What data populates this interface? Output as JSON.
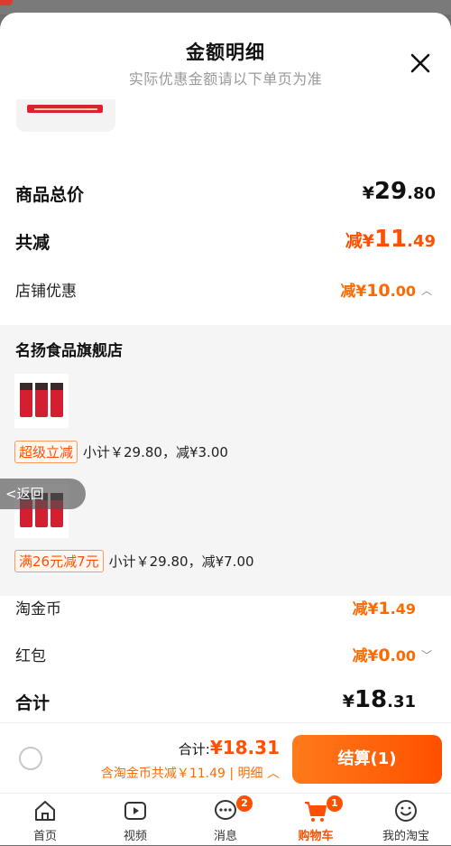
{
  "header": {
    "title": "金额明细",
    "subtitle": "实际优惠金额请以下单页为准"
  },
  "summary": {
    "total_label": "商品总价",
    "total_amount": {
      "symbol": "¥",
      "int": "29",
      "dec": ".80"
    },
    "saved_label": "共减",
    "saved_amount": {
      "prefix": "减¥",
      "int": "11",
      "dec": ".49"
    },
    "store_discount_label": "店铺优惠",
    "store_discount_amount": {
      "prefix": "减¥",
      "int": "10",
      "dec": ".00"
    }
  },
  "store": {
    "name": "名扬食品旗舰店",
    "items": [
      {
        "tag": "超级立减",
        "text": "小计￥29.80，减¥3.00"
      },
      {
        "tag": "满26元减7元",
        "text": "小计￥29.80，减¥7.00"
      }
    ]
  },
  "coins": {
    "label": "淘金币",
    "amount": {
      "prefix": "减¥",
      "int": "1",
      "dec": ".49"
    }
  },
  "redpacket": {
    "label": "红包",
    "amount": {
      "prefix": "减¥",
      "int": "0",
      "dec": ".00"
    }
  },
  "grand": {
    "label": "合计",
    "amount": {
      "symbol": "¥",
      "int": "18",
      "dec": ".31"
    }
  },
  "back_pill": {
    "label": "返回"
  },
  "footer": {
    "total_prefix": "合计:",
    "total_value": "¥18.31",
    "coin_text": "含淘金币共减￥11.49 | 明细",
    "checkout_label": "结算(1)"
  },
  "tabbar": {
    "items": [
      {
        "label": "首页",
        "icon": "home-icon"
      },
      {
        "label": "视频",
        "icon": "video-icon"
      },
      {
        "label": "消息",
        "icon": "message-icon",
        "badge": "2"
      },
      {
        "label": "购物车",
        "icon": "cart-icon",
        "badge": "1",
        "active": true
      },
      {
        "label": "我的淘宝",
        "icon": "profile-icon"
      }
    ]
  },
  "colors": {
    "accent": "#ff5000",
    "panel": "#f5f5f5"
  }
}
